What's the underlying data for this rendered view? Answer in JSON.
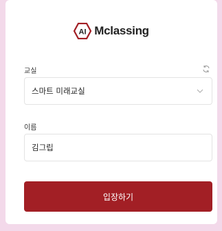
{
  "brand": {
    "logo_text": "Mclassing",
    "logo_mark": "AI"
  },
  "classroom": {
    "label": "교실",
    "selected": "스마트 미래교실",
    "refresh_icon": "refresh-icon",
    "dropdown_icon": "chevron-down-icon"
  },
  "name": {
    "label": "이름",
    "value": "김그립"
  },
  "submit": {
    "label": "입장하기"
  },
  "colors": {
    "accent": "#a21f25",
    "background": "#f3d9ea"
  }
}
